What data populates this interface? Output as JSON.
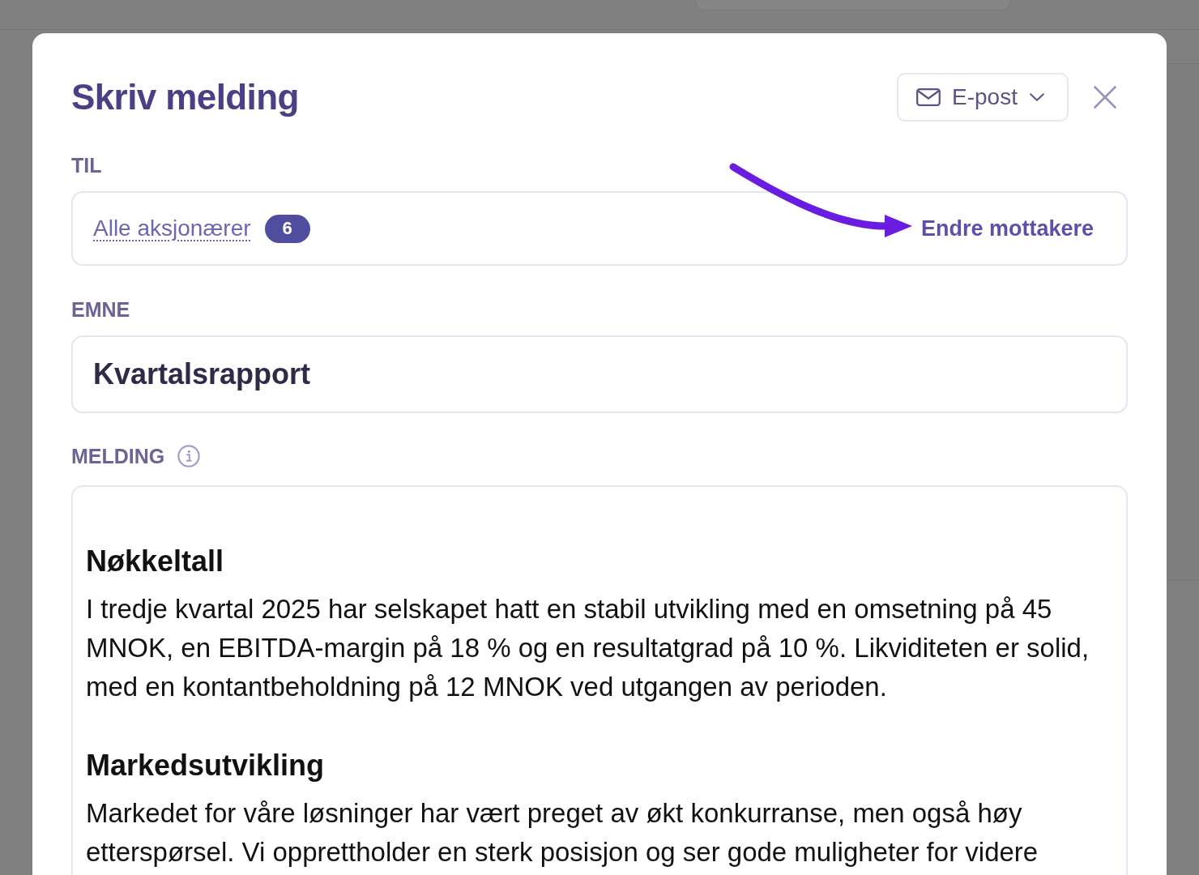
{
  "dialog": {
    "title": "Skriv melding",
    "channel_menu": {
      "label": "E-post"
    }
  },
  "fields": [
    {
      "kind": "recipients",
      "label": "TIL",
      "recipients": {
        "label": "Alle aksjonærer",
        "count": "6"
      },
      "action": {
        "label": "Endre mottakere",
        "highlighted": true
      }
    },
    {
      "kind": "text",
      "label": "EMNE",
      "value": "Kvartalsrapport"
    },
    {
      "kind": "rich_text",
      "label": "MELDING",
      "info": true,
      "blocks": [
        {
          "kind": "heading",
          "text": "Nøkkeltall"
        },
        {
          "kind": "paragraph",
          "text": "I tredje kvartal 2025 har selskapet hatt en stabil utvikling med en omsetning på 45 MNOK, en EBITDA-margin på 18 % og en resultatgrad på 10 %. Likviditeten er solid, med en kontantbeholdning på 12 MNOK ved utgangen av perioden."
        },
        {
          "kind": "heading",
          "text": "Markedsutvikling"
        },
        {
          "kind": "paragraph",
          "text": "Markedet for våre løsninger har vært preget av økt konkurranse, men også høy etterspørsel. Vi opprettholder en sterk posisjon og ser gode muligheter for videre"
        }
      ]
    }
  ]
}
